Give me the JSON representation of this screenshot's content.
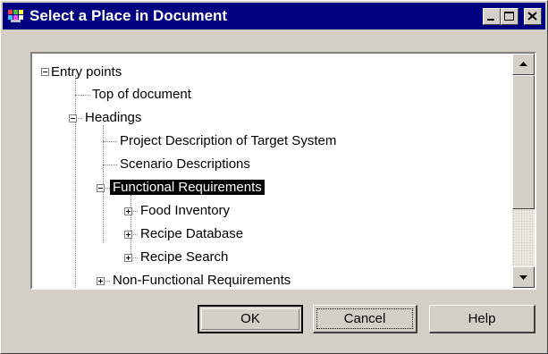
{
  "window": {
    "title": "Select a Place in Document"
  },
  "titlebar_buttons": {
    "minimize": "minimize-icon",
    "maximize": "maximize-icon",
    "close": "close-icon"
  },
  "tree": {
    "nodes": [
      {
        "label": "Entry points",
        "expander": "minus"
      },
      {
        "label": "Top of document"
      },
      {
        "label": "Headings",
        "expander": "minus"
      },
      {
        "label": "Project Description of Target System"
      },
      {
        "label": "Scenario Descriptions"
      },
      {
        "label": "Functional Requirements",
        "expander": "minus",
        "selected": true
      },
      {
        "label": "Food Inventory",
        "expander": "plus"
      },
      {
        "label": "Recipe Database",
        "expander": "plus"
      },
      {
        "label": "Recipe Search",
        "expander": "plus"
      },
      {
        "label": "Non-Functional Requirements",
        "expander": "plus"
      }
    ]
  },
  "buttons": {
    "ok": "OK",
    "cancel": "Cancel",
    "help": "Help"
  }
}
